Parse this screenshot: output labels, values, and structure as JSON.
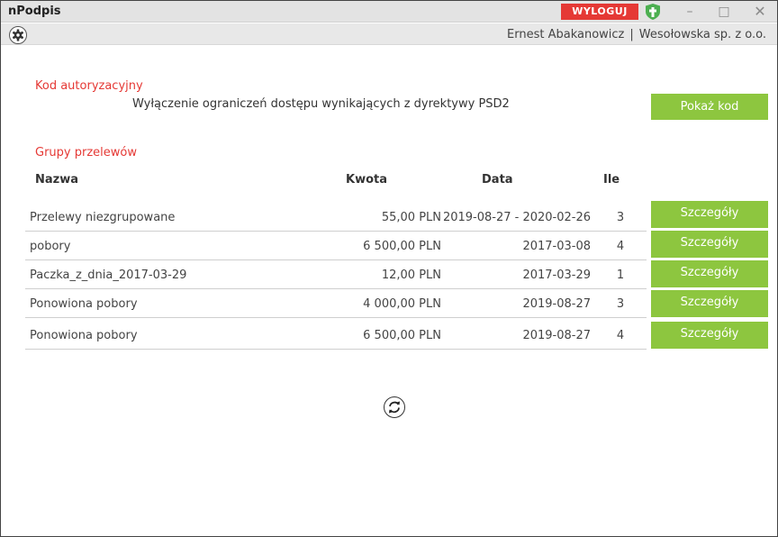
{
  "app": {
    "title": "nPodpis",
    "logout_label": "WYLOGUJ",
    "window_controls": {
      "minimize": "–",
      "maximize": "□",
      "close": "✕"
    }
  },
  "toolbar": {
    "settings_icon": "gear-icon",
    "user_name": "Ernest Abakanowicz",
    "separator": "|",
    "company": "Wesołowska sp. z o.o."
  },
  "auth": {
    "section_label": "Kod autoryzacyjny",
    "description": "Wyłączenie ograniczeń dostępu wynikających z dyrektywy PSD2",
    "show_code_label": "Pokaż kod"
  },
  "groups": {
    "section_label": "Grupy przelewów",
    "columns": {
      "name": "Nazwa",
      "amount": "Kwota",
      "date": "Data",
      "count": "Ile"
    },
    "rows": [
      {
        "name": "Przelewy niezgrupowane",
        "amount": "55,00 PLN",
        "date": "2019-08-27 - 2020-02-26",
        "count": "3",
        "action": "Szczegóły"
      },
      {
        "name": "pobory",
        "amount": "6 500,00 PLN",
        "date": "2017-03-08",
        "count": "4",
        "action": "Szczegóły"
      },
      {
        "name": "Paczka_z_dnia_2017-03-29",
        "amount": "12,00 PLN",
        "date": "2017-03-29",
        "count": "1",
        "action": "Szczegóły"
      },
      {
        "name": "Ponowiona pobory",
        "amount": "4 000,00 PLN",
        "date": "2019-08-27",
        "count": "3",
        "action": "Szczegóły"
      },
      {
        "name": "Ponowiona pobory",
        "amount": "6 500,00 PLN",
        "date": "2019-08-27",
        "count": "4",
        "action": "Szczegóły"
      }
    ]
  },
  "refresh_icon": "refresh-icon",
  "colors": {
    "accent_green": "#8dc63f",
    "logout_red": "#e53935",
    "section_red": "#e53935",
    "shield_green": "#4caf50"
  }
}
